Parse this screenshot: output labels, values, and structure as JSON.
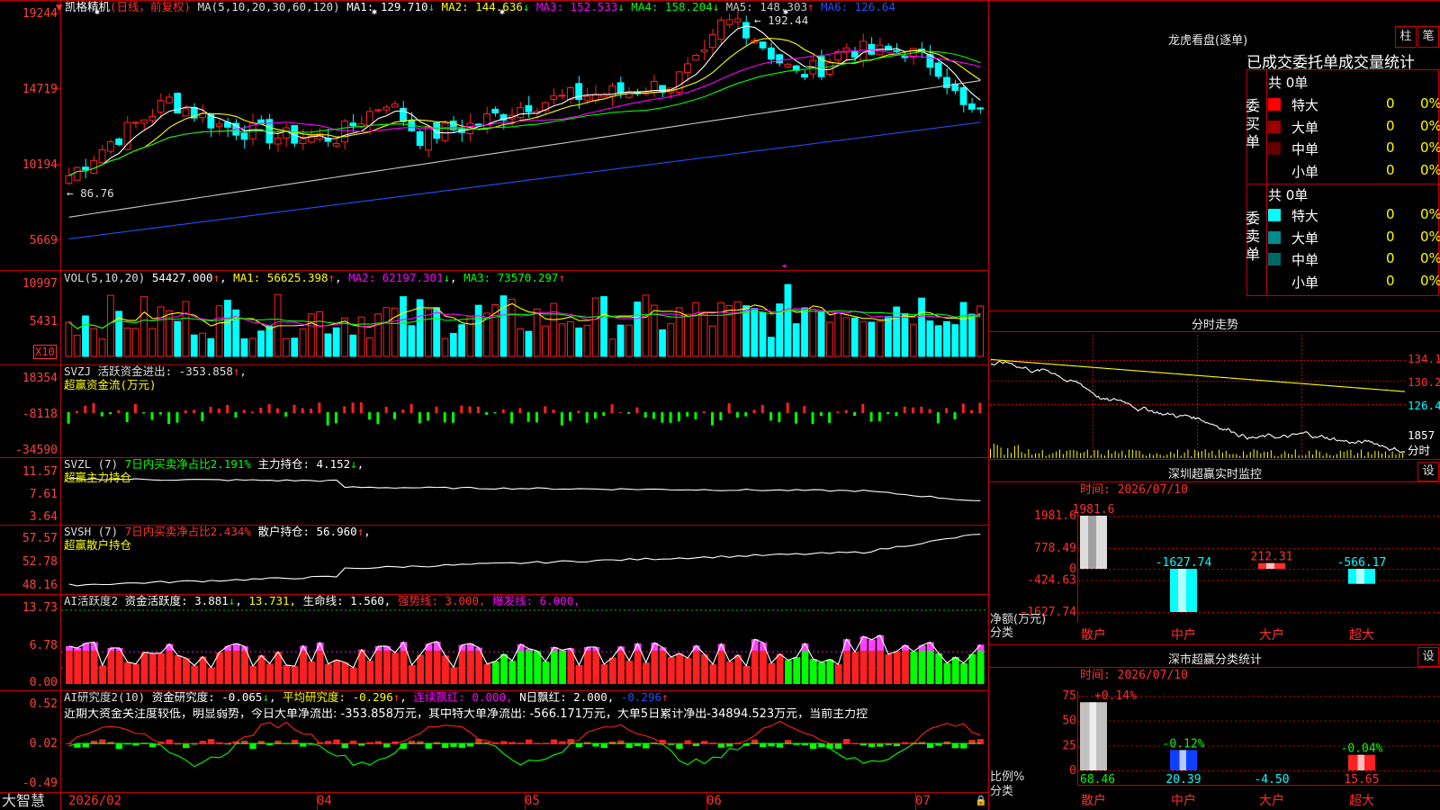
{
  "stock": {
    "name": "凯格精机",
    "period": "(日线，前复权)",
    "ma_legend": {
      "label": "MA(5,10,20,30,60,120)",
      "items": [
        {
          "name": "MA1:",
          "value": "129.710",
          "arrow": "↓",
          "color": "#ffffff"
        },
        {
          "name": "MA2:",
          "value": "144.636",
          "arrow": "↓",
          "color": "#ffff00"
        },
        {
          "name": "MA3:",
          "value": "152.533",
          "arrow": "↓",
          "color": "#ff00ff"
        },
        {
          "name": "MA4:",
          "value": "158.204",
          "arrow": "↓",
          "color": "#00ff00"
        },
        {
          "name": "MA5:",
          "value": "148.303",
          "arrow": "↑",
          "color": "#c8c8c8"
        },
        {
          "name": "MA6:",
          "value": "126.64",
          "arrow": "",
          "color": "#2050ff"
        }
      ]
    },
    "price_labels": [
      "19244",
      "14719",
      "10194",
      "5669"
    ],
    "high_mark": "192.44",
    "low_mark": "86.76"
  },
  "vol": {
    "legend": "VOL(5,10,20)",
    "value": "54427.000",
    "ma1": "MA1: 56625.398",
    "ma2": "MA2: 62197.301",
    "ma3": "MA3: 73570.297",
    "labels": [
      "10997",
      "5431"
    ],
    "unit": "X10"
  },
  "svzj": {
    "legend": "SVZJ  活跃资金进出: -353.858",
    "sub": "超赢资金流(万元)",
    "labels": [
      "18354",
      "-8118",
      "-34590"
    ]
  },
  "svzl": {
    "legend": "SVZL (7)",
    "a": "7日内买卖净占比2.191%",
    "b": "主力持仓: 4.152",
    "sub": "超赢主力持仓",
    "labels": [
      "11.57",
      "7.61",
      "3.64"
    ]
  },
  "svsh": {
    "legend": "SVSH (7)",
    "a": "7日内买卖净占比2.434%",
    "b": "散户持仓: 56.960",
    "sub": "超赢散户持仓",
    "labels": [
      "57.57",
      "52.78",
      "48.16"
    ]
  },
  "ai2": {
    "legend": "AI活跃度2",
    "a": "资金活跃度: 3.881",
    "b": "13.731,",
    "c": "生命线: 1.560,",
    "d": "强势线: 3.000,",
    "e": "爆发线: 6.000,",
    "labels": [
      "13.73",
      "6.78",
      "0.00"
    ]
  },
  "ai_research": {
    "legend": "AI研究度2(10)",
    "a": "资金研究度: -0.065",
    "b": "平均研究度: -0.296",
    "c": "连续飘红: 0.000,",
    "d": "N日飘红: 2.000,",
    "e": "-0.296",
    "comment": "近期大资金关注度较低，明显弱势，今日大单净流出: -353.858万元，其中特大单净流出: -566.171万元，大单5日累计净出-34894.523万元，当前主力控",
    "labels": [
      "0.52",
      "0.02",
      "-0.49"
    ]
  },
  "xaxis": {
    "brand": "大智慧",
    "labels": [
      "2026/02",
      "04",
      "05",
      "06",
      "07"
    ]
  },
  "longhu": {
    "title": "龙虎看盘(逐单)",
    "btn1": "柱",
    "btn2": "笔",
    "header": "已成交委托单成交量统计",
    "buy_side": "委买单",
    "sell_side": "委卖单",
    "buy_total": "共 0单",
    "sell_total": "共 0单",
    "buy_rows": [
      {
        "label": "特大",
        "v": "0",
        "p": "0%",
        "color": "#ff0000"
      },
      {
        "label": "大单",
        "v": "0",
        "p": "0%",
        "color": "#9a0000"
      },
      {
        "label": "中单",
        "v": "0",
        "p": "0%",
        "color": "#600000"
      },
      {
        "label": "小单",
        "v": "0",
        "p": "0%",
        "color": "#000000"
      }
    ],
    "sell_rows": [
      {
        "label": "特大",
        "v": "0",
        "p": "0%",
        "color": "#00ffff"
      },
      {
        "label": "大单",
        "v": "0",
        "p": "0%",
        "color": "#008c8c"
      },
      {
        "label": "中单",
        "v": "0",
        "p": "0%",
        "color": "#006868"
      },
      {
        "label": "小单",
        "v": "0",
        "p": "0%",
        "color": "#000000"
      }
    ]
  },
  "fenshi": {
    "title": "分时走势",
    "labels": [
      "134.1",
      "130.2",
      "126.4",
      "1857"
    ],
    "unit": "分时"
  },
  "sz_realtime": {
    "title": "深圳超赢实时监控",
    "btn": "设",
    "time": "时间: 2026/07/10",
    "ylabels": [
      "1981.6",
      "778.49",
      "0",
      "-424.63",
      "-1627.74"
    ],
    "axis_name": "净额(万元)",
    "cat_name": "分类",
    "chart_data": {
      "type": "bar",
      "categories": [
        "散户",
        "中户",
        "大户",
        "超大"
      ],
      "values": [
        1981.6,
        -1627.74,
        212.31,
        -566.17
      ],
      "value_labels": [
        "1981.6",
        "-1627.74",
        "212.31",
        "-566.17"
      ],
      "ylim": [
        -1627.74,
        1981.6
      ]
    }
  },
  "sz_class": {
    "title": "深市超赢分类统计",
    "btn": "设",
    "time": "时间: 2026/07/10",
    "ylabels": [
      "75",
      "50",
      "25",
      "0"
    ],
    "axis_name": "比例%",
    "cat_name": "分类",
    "chart_data": {
      "type": "bar",
      "categories": [
        "散户",
        "中户",
        "大户",
        "超大"
      ],
      "values": [
        68.46,
        20.39,
        -4.5,
        15.65
      ],
      "change_labels": [
        "+0.14%",
        "-0.12%",
        "",
        "-0.04%"
      ],
      "value_labels": [
        "68.46",
        "20.39",
        "-4.50",
        "15.65"
      ],
      "ylim": [
        0,
        75
      ]
    }
  }
}
